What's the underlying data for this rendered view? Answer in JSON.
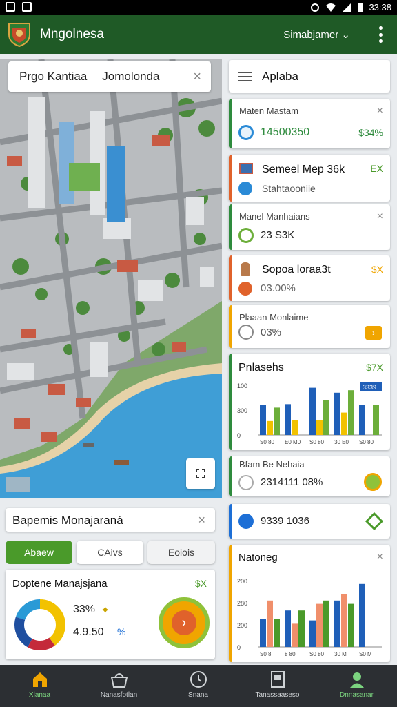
{
  "status": {
    "time": "33:38"
  },
  "app": {
    "name": "Mngolnesa",
    "user": "Simabjamer",
    "dropdown": "⌄"
  },
  "map": {
    "search": {
      "part1": "Prgo Kantiaa",
      "part2": "Jomolonda"
    },
    "close": "×"
  },
  "left_panel": {
    "header_title": "Bapemis Monajaraná",
    "close": "×",
    "tabs": [
      {
        "label": "Abaew",
        "active": true
      },
      {
        "label": "CAivs",
        "active": false
      },
      {
        "label": "Eoiois",
        "active": false
      }
    ],
    "card": {
      "title": "Doptene Manajsjana",
      "badge": "$X",
      "pct": "33%",
      "amount": "4.9.50",
      "suffix": "%",
      "donut": [
        {
          "value": 40,
          "color": "#f2c200"
        },
        {
          "value": 18,
          "color": "#c42a3a"
        },
        {
          "value": 22,
          "color": "#1f4fa0"
        },
        {
          "value": 20,
          "color": "#2a9ad6"
        }
      ]
    }
  },
  "right_panel": {
    "header": {
      "title": "Aplaba"
    },
    "cards": [
      {
        "label": "Maten Mastam",
        "close": "×",
        "value": "14500350",
        "change": "$34%",
        "accent": "#2e8b3d"
      },
      {
        "label": "Semeel Mep 36k",
        "close": "EX",
        "sub": "Stahtaooniie",
        "accent": "#e0622b"
      },
      {
        "label": "Manel Manhaians",
        "close": "×",
        "value": "23 S3K",
        "accent": "#2e8b3d"
      },
      {
        "label": "Sopoa loraa3t",
        "close": "$X",
        "value": "03.00%",
        "accent": "#e0622b"
      },
      {
        "label": "Plaaan Monlaime",
        "value": "03%",
        "accent": "#f0a500"
      }
    ],
    "chart1": {
      "title": "Pnlasehs",
      "badge": "$7X"
    },
    "card7": {
      "label": "Bfam Be Nehaia",
      "value": "2314111 08%",
      "accent": "#2e8b3d"
    },
    "card8": {
      "value": "9339 1036",
      "accent": "#1d6fd6"
    },
    "chart2": {
      "title": "Natoneg",
      "close": "×"
    }
  },
  "chart_data": [
    {
      "type": "bar",
      "title": "Pnlasehs",
      "categories": [
        "S0 80",
        "E0 M0",
        "S0 80",
        "30 E0",
        "S0 80"
      ],
      "yticks": [
        "100",
        "300",
        "0"
      ],
      "ylim": [
        0,
        100
      ],
      "highlight_label": "3339",
      "series": [
        {
          "values": [
            60,
            62,
            95,
            85,
            60
          ]
        },
        {
          "values": [
            28,
            30,
            30,
            45,
            0
          ]
        },
        {
          "values": [
            55,
            0,
            70,
            90,
            60
          ]
        }
      ]
    },
    {
      "type": "bar",
      "title": "Natoneg",
      "categories": [
        "S0 8",
        "8 80",
        "S0 80",
        "30 M",
        "S0 M"
      ],
      "yticks": [
        "200",
        "280",
        "200",
        "0"
      ],
      "ylim": [
        0,
        100
      ],
      "series": [
        {
          "values": [
            42,
            55,
            40,
            70,
            95
          ]
        },
        {
          "values": [
            70,
            35,
            65,
            80,
            0
          ]
        },
        {
          "values": [
            42,
            55,
            70,
            65,
            0
          ]
        }
      ]
    }
  ],
  "nav": [
    {
      "label": "Xlanaa",
      "icon": "home-icon",
      "active": true
    },
    {
      "label": "Nanasfotlan",
      "icon": "basket-icon",
      "active": false
    },
    {
      "label": "Snana",
      "icon": "clock-icon",
      "active": false
    },
    {
      "label": "Tanassaaseso",
      "icon": "device-icon",
      "active": false
    },
    {
      "label": "Dnnasanar",
      "icon": "profile-icon",
      "active": true
    }
  ],
  "colors": {
    "primary": "#1f5a26",
    "green": "#5aa02c",
    "orange": "#f0a500",
    "blue": "#1d6fd6"
  }
}
